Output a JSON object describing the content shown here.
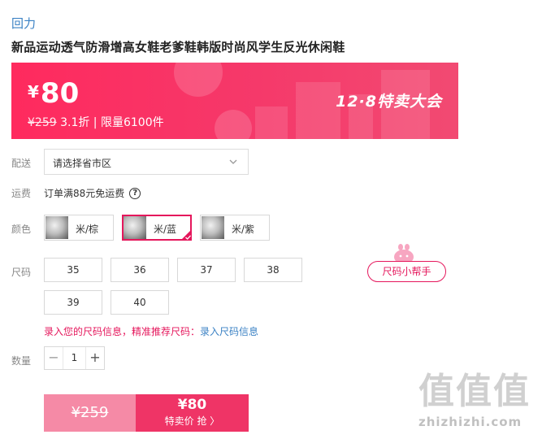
{
  "brand": "回力",
  "product_title": "新品运动透气防滑增高女鞋老爹鞋韩版时尚风学生反光休闲鞋",
  "banner": {
    "currency": "¥",
    "price": "80",
    "original_price": "¥259",
    "discount_text": "3.1折 | 限量6100件",
    "event_label": "12·8特卖大会"
  },
  "delivery": {
    "label": "配送",
    "select_value": "请选择省市区"
  },
  "shipping": {
    "label": "运费",
    "text": "订单满88元免运费",
    "help_glyph": "?"
  },
  "color": {
    "label": "颜色",
    "options": [
      {
        "label": "米/棕"
      },
      {
        "label": "米/蓝",
        "selected": true
      },
      {
        "label": "米/紫"
      }
    ]
  },
  "size": {
    "label": "尺码",
    "options": [
      "35",
      "36",
      "37",
      "38",
      "39",
      "40"
    ],
    "helper_button": "尺码小帮手",
    "tip_text": "录入您的尺码信息，精准推荐尺码：",
    "tip_link": "录入尺码信息"
  },
  "quantity": {
    "label": "数量",
    "value": "1",
    "minus": "−",
    "plus": "+"
  },
  "buy_button": {
    "original_price": "¥259",
    "price": "¥80",
    "action": "特卖价 抢 〉"
  },
  "watermark": {
    "big": "值值值",
    "small": "zhizhizhi.com"
  },
  "colors": {
    "accent": "#e5175c",
    "link": "#3b82c4",
    "banner_start": "#ff2a5e",
    "buy_left": "#f58aa6",
    "buy_right": "#ef3466"
  }
}
